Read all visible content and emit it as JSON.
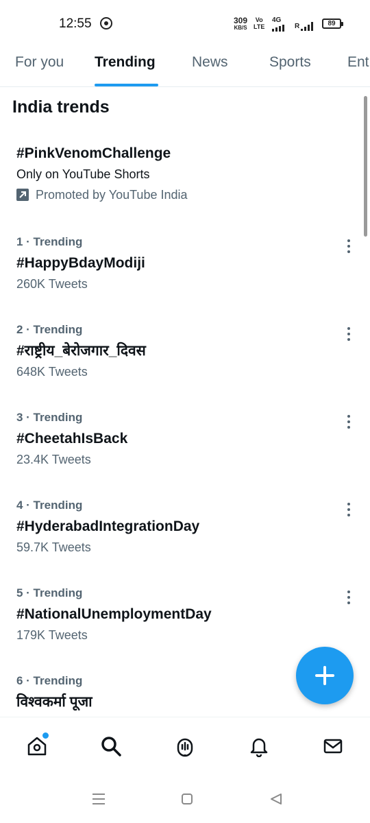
{
  "status_bar": {
    "time": "12:55",
    "net_speed_value": "309",
    "net_speed_unit": "KB/S",
    "volte_top": "Vo",
    "volte_bottom": "LTE",
    "network_type": "4G",
    "carrier_r": "R",
    "battery": "89"
  },
  "tabs": [
    {
      "label": "For you",
      "active": false
    },
    {
      "label": "Trending",
      "active": true
    },
    {
      "label": "News",
      "active": false
    },
    {
      "label": "Sports",
      "active": false
    },
    {
      "label": "Ent",
      "active": false
    }
  ],
  "section_title": "India trends",
  "promoted": {
    "title": "#PinkVenomChallenge",
    "subtitle": "Only on YouTube Shorts",
    "promoted_by": "Promoted by YouTube India"
  },
  "trends": [
    {
      "meta": "1 · Trending",
      "name": "#HappyBdayModiji",
      "count": "260K Tweets"
    },
    {
      "meta": "2 · Trending",
      "name": "#राष्ट्रीय_बेरोजगार_दिवस",
      "count": "648K Tweets"
    },
    {
      "meta": "3 · Trending",
      "name": "#CheetahIsBack",
      "count": "23.4K Tweets"
    },
    {
      "meta": "4 · Trending",
      "name": "#HyderabadIntegrationDay",
      "count": "59.7K Tweets"
    },
    {
      "meta": "5 · Trending",
      "name": "#NationalUnemploymentDay",
      "count": "179K Tweets"
    },
    {
      "meta": "6 · Trending",
      "name": "विश्वकर्मा पूजा",
      "count": ""
    }
  ],
  "bottom_nav": [
    "home-icon",
    "search-icon",
    "spaces-icon",
    "notifications-icon",
    "messages-icon"
  ],
  "colors": {
    "accent": "#1d9bf0",
    "text_primary": "#0f1419",
    "text_secondary": "#536471"
  }
}
